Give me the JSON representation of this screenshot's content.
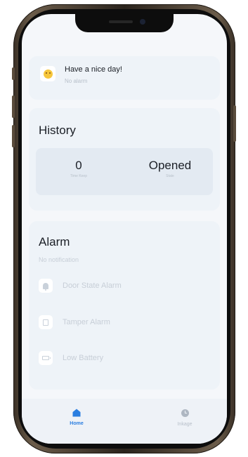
{
  "greeting": {
    "title": "Have a nice day!",
    "subtitle": "No alarm"
  },
  "history": {
    "title": "History",
    "stats": [
      {
        "value": "0",
        "label": "Time Keep"
      },
      {
        "value": "Opened",
        "label": "State"
      }
    ]
  },
  "alarm": {
    "title": "Alarm",
    "subtitle": "No notification",
    "items": [
      {
        "label": "Door State Alarm",
        "icon": "bell-icon"
      },
      {
        "label": "Tamper Alarm",
        "icon": "tamper-icon"
      },
      {
        "label": "Low Battery",
        "icon": "battery-icon"
      }
    ]
  },
  "nav": {
    "items": [
      {
        "label": "Home",
        "icon": "home-icon",
        "active": true
      },
      {
        "label": "Inkage",
        "icon": "clock-icon",
        "active": false
      }
    ]
  },
  "colors": {
    "accent": "#2a7ee0",
    "emoji": "#f6c63c",
    "card_background": "#eef3f8"
  }
}
